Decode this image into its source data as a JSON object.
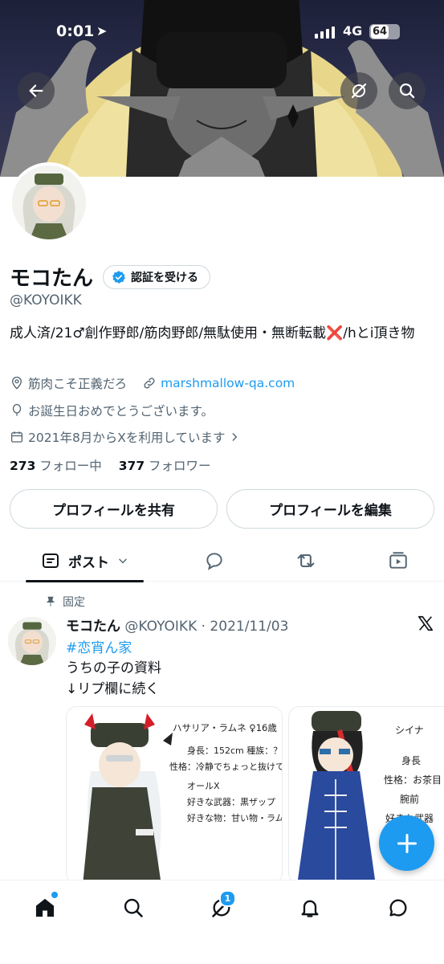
{
  "status_bar": {
    "time": "0:01",
    "network": "4G",
    "battery": "64"
  },
  "profile": {
    "name": "モコたん",
    "verify_label": "認証を受ける",
    "handle": "@KOYOIKK",
    "bio_before": "成人済/21♂創作野郎/筋肉野郎/無駄使用・無断転載",
    "bio_mark": "❌",
    "bio_after": "/hとi頂き物",
    "location": "筋肉こそ正義だろ",
    "website": "marshmallow-qa.com",
    "birthday": "お誕生日おめでとうございます。",
    "joined": "2021年8月からXを利用しています",
    "following_count": "273",
    "following_label": "フォロー中",
    "followers_count": "377",
    "followers_label": "フォロワー"
  },
  "buttons": {
    "share": "プロフィールを共有",
    "edit": "プロフィールを編集"
  },
  "tabs": {
    "posts": "ポスト"
  },
  "pinned_tweet": {
    "pinned_label": "固定",
    "author": "モコたん",
    "handle_date": "@KOYOIKK · 2021/11/03",
    "hashtag": "#恋宵ん家",
    "line1": "うちの子の資料",
    "line2": "↓リプ欄に続く",
    "media1": {
      "title": "ハサリア・ラムネ ♀16歳",
      "line1": "身長：152cm 種族：？",
      "line2": "性格：冷静でちょっと抜けてる",
      "line3": "オールX",
      "line4": "好きな武器：黒ザップ",
      "line5": "好きな物：甘い物・ラムネ"
    },
    "media2": {
      "title": "シイナ",
      "line1": "身長",
      "line2": "性格：お茶目",
      "line3": "腕前",
      "line4": "好きな武器"
    }
  },
  "bottom_nav": {
    "messages_badge": "1"
  },
  "colors": {
    "accent": "#1d9bf0",
    "text": "#0f1419",
    "secondary": "#536471",
    "border": "#cfd9de"
  }
}
